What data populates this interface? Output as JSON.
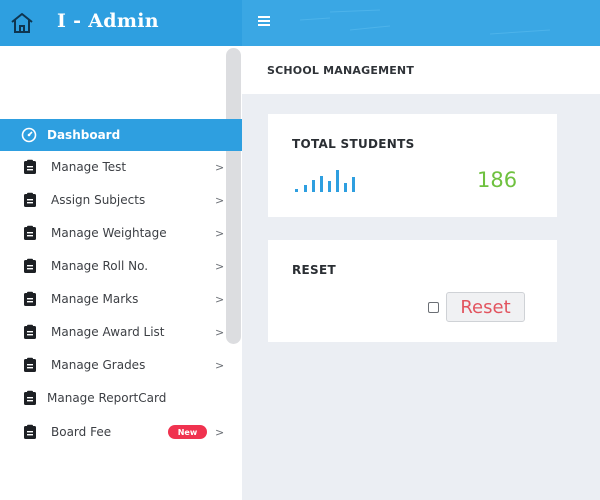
{
  "app": {
    "title": "I - Admin"
  },
  "header": {
    "title": "SCHOOL MANAGEMENT"
  },
  "sidebar": {
    "items": [
      {
        "label": "Dashboard",
        "icon": "dashboard-icon",
        "active": true,
        "chevron": false
      },
      {
        "label": "Manage Test",
        "icon": "clipboard-icon",
        "chevron": true
      },
      {
        "label": "Assign Subjects",
        "icon": "clipboard-icon",
        "chevron": true
      },
      {
        "label": "Manage Weightage",
        "icon": "clipboard-icon",
        "chevron": true
      },
      {
        "label": "Manage Roll No.",
        "icon": "clipboard-icon",
        "chevron": true
      },
      {
        "label": "Manage Marks",
        "icon": "clipboard-icon",
        "chevron": true
      },
      {
        "label": "Manage Award List",
        "icon": "clipboard-icon",
        "chevron": true
      },
      {
        "label": "Manage Grades",
        "icon": "clipboard-icon",
        "chevron": true
      },
      {
        "label": "Manage ReportCard",
        "icon": "clipboard-icon",
        "chevron": false
      },
      {
        "label": "Board Fee",
        "icon": "clipboard-icon",
        "chevron": true,
        "badge": "New"
      }
    ]
  },
  "cards": {
    "students": {
      "title": "TOTAL STUDENTS",
      "value": "186"
    },
    "reset": {
      "title": "RESET",
      "button_label": "Reset"
    }
  },
  "colors": {
    "accent": "#2e9fe0",
    "topbar": "#3aa7e4",
    "count": "#6fc13f",
    "badge": "#f0324f",
    "reset_text": "#e2545f"
  }
}
